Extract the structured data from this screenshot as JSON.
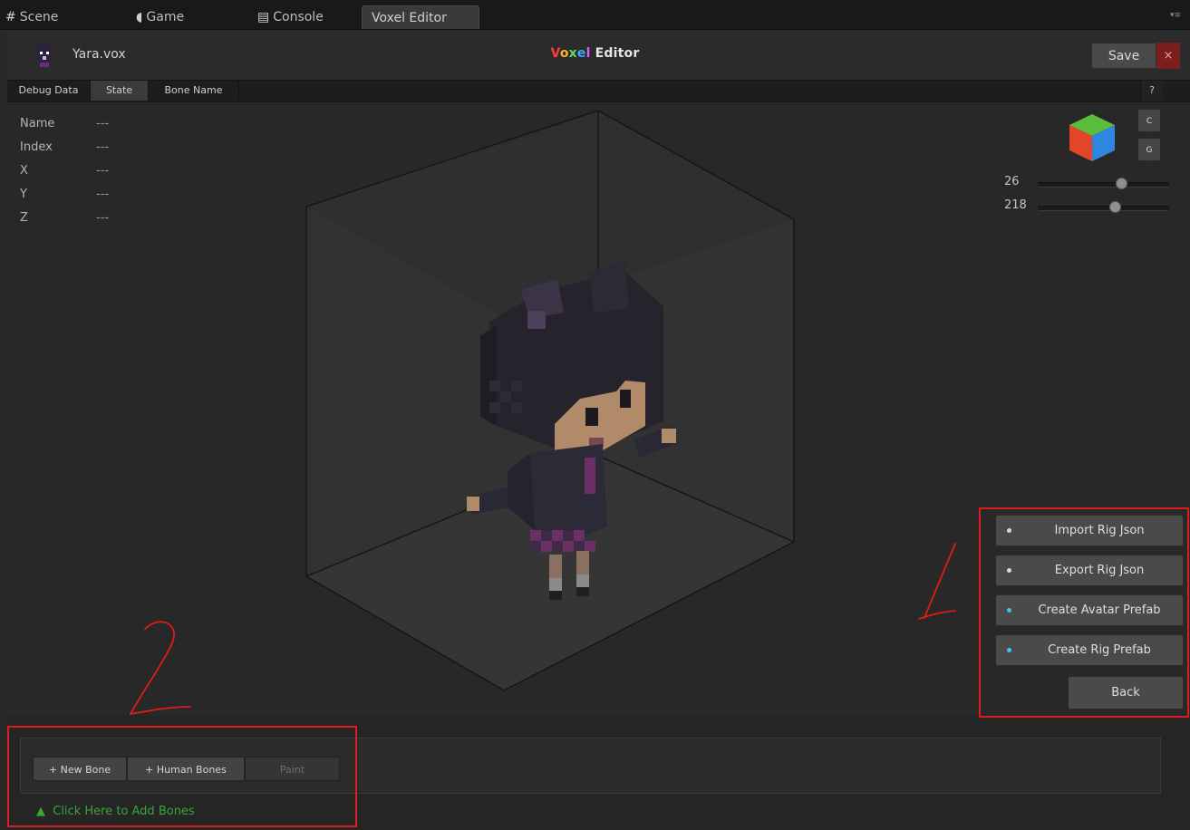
{
  "tabs": {
    "scene": "Scene",
    "game": "Game",
    "console": "Console",
    "voxel_editor": "Voxel Editor"
  },
  "header": {
    "file_name": "Yara.vox",
    "title_part1": "Vox",
    "title_part2": "el",
    "title_part3": " Editor",
    "save_label": "Save",
    "close_label": "×"
  },
  "toolbar": {
    "debug_data": "Debug Data",
    "state": "State",
    "bone_name": "Bone Name",
    "help": "?"
  },
  "info": {
    "name_label": "Name",
    "name_value": "---",
    "index_label": "Index",
    "index_value": "---",
    "x_label": "X",
    "x_value": "---",
    "y_label": "Y",
    "y_value": "---",
    "z_label": "Z",
    "z_value": "---"
  },
  "view_controls": {
    "c_button": "C",
    "g_button": "G",
    "slider1_value": "26",
    "slider1_position": 0.64,
    "slider2_value": "218",
    "slider2_position": 0.59
  },
  "actions": {
    "import_rig": "Import Rig Json",
    "export_rig": "Export Rig Json",
    "create_avatar": "Create Avatar Prefab",
    "create_rig": "Create Rig Prefab",
    "back": "Back"
  },
  "bottom": {
    "new_bone": "+ New Bone",
    "human_bones": "+ Human Bones",
    "paint": "Paint",
    "add_bones_hint": "Click Here to Add Bones",
    "hint_icon": "▲"
  },
  "annotations": {
    "mark1": "1",
    "mark2": "2"
  },
  "colors": {
    "annotation_red": "#e01b1b",
    "hint_green": "#3aa53a",
    "dot_blue": "#3ec3f2"
  }
}
